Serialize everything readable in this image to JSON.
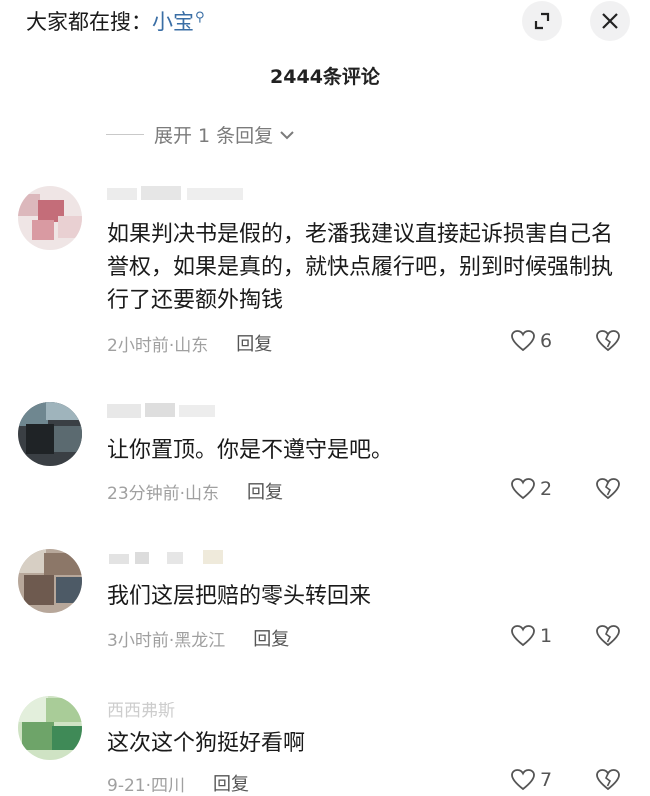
{
  "header": {
    "search_prefix": "大家都在搜：",
    "search_keyword": "小宝",
    "comment_count_title": "2444条评论"
  },
  "expand_replies": "展开 1 条回复",
  "comments": [
    {
      "text": "如果判决书是假的，老潘我建议直接起诉损害自己名誉权，如果是真的，就快点履行吧，别到时候强制执行了还要额外掏钱",
      "time_location": "2小时前·山东",
      "reply_label": "回复",
      "likes": "6"
    },
    {
      "text": "让你置顶。你是不遵守是吧。",
      "time_location": "23分钟前·山东",
      "reply_label": "回复",
      "likes": "2"
    },
    {
      "text": "我们这层把赔的零头转回来",
      "time_location": "3小时前·黑龙江",
      "reply_label": "回复",
      "likes": "1"
    },
    {
      "username": "西西弗斯",
      "text": "这次这个狗挺好看啊",
      "time_location": "9-21·四川",
      "reply_label": "回复",
      "likes": "7"
    }
  ]
}
